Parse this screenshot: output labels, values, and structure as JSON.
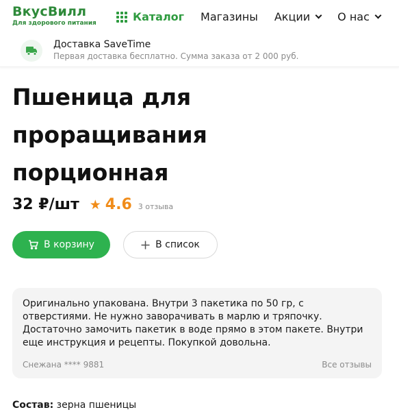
{
  "header": {
    "logo_title": "ВкусВилл",
    "logo_subtitle": "Для здорового питания",
    "nav": {
      "catalog": "Каталог",
      "stores": "Магазины",
      "promotions": "Акции",
      "about": "О нас"
    }
  },
  "delivery": {
    "title": "Доставка SaveTime",
    "subtitle": "Первая доставка бесплатно. Сумма заказа от 2 000 руб."
  },
  "product": {
    "title": "Пшеница для проращивания порционная",
    "price": "32 ₽/шт",
    "rating": "4.6",
    "reviews_count": "3 отзыва",
    "cart_button": "В корзину",
    "list_button": "В список"
  },
  "review": {
    "text": "Оригинально упакована. Внутри 3 пакетика по 50 гр, с отверстиями. Не нужно заворачивать в марлю и тряпочку. Достаточно замочить пакетик в воде прямо в этом пакете. Внутри еще инструкция и рецепты. Покупкой довольна.",
    "author": "Снежана **** 9881",
    "all_reviews": "Все отзывы"
  },
  "composition": {
    "label": "Состав:",
    "value": "зерна пшеницы"
  },
  "colors": {
    "brand_green": "#2e8a3a",
    "button_green": "#2eb24f",
    "rating_orange": "#f08c1a"
  }
}
